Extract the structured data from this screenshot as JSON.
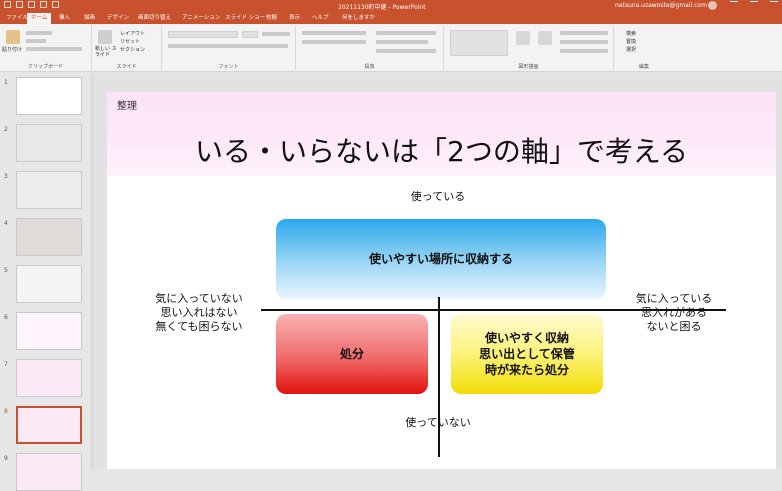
{
  "window": {
    "doc_title": "20211130町中継 - PowerPoint",
    "account": "natsuna.uzawoste@gmail.com"
  },
  "tabs": [
    "ファイル",
    "ホーム",
    "挿入",
    "描画",
    "デザイン",
    "画面切り替え",
    "アニメーション",
    "スライド ショー",
    "校閲",
    "表示",
    "ヘルプ",
    "何をしますか"
  ],
  "ribbon": {
    "groups": [
      "クリップボード",
      "スライド",
      "フォント",
      "段落",
      "図形描画",
      "編集"
    ],
    "paste": "貼り付け",
    "new_slide": "新しい スライド",
    "layout": "レイアウト",
    "reset": "リセット",
    "section": "セクション",
    "find": "検索",
    "replace": "置換",
    "select": "選択"
  },
  "slides_panel": {
    "numbers": [
      "1",
      "2",
      "3",
      "4",
      "5",
      "6",
      "7",
      "8",
      "9"
    ],
    "selected_index": 8
  },
  "slide": {
    "section_label": "整理",
    "title": "いる・いらないは「2つの軸」で考える",
    "axis_top": "使っている",
    "axis_bottom": "使っていない",
    "axis_left": [
      "気に入っていない",
      "思い入れはない",
      "無くても困らない"
    ],
    "axis_right": [
      "気に入っている",
      "思入れがある",
      "ないと困る"
    ],
    "box_top": "使いやすい場所に収納する",
    "box_bottom_left": "処分",
    "box_bottom_right": [
      "使いやすく収納",
      "思い出として保管",
      "時が来たら処分"
    ],
    "colors": {
      "title_band": "#fbe3f6",
      "box_top": "#2aa8ec",
      "box_bottom_left": "#e0120e",
      "box_bottom_right": "#f2dc05"
    }
  }
}
